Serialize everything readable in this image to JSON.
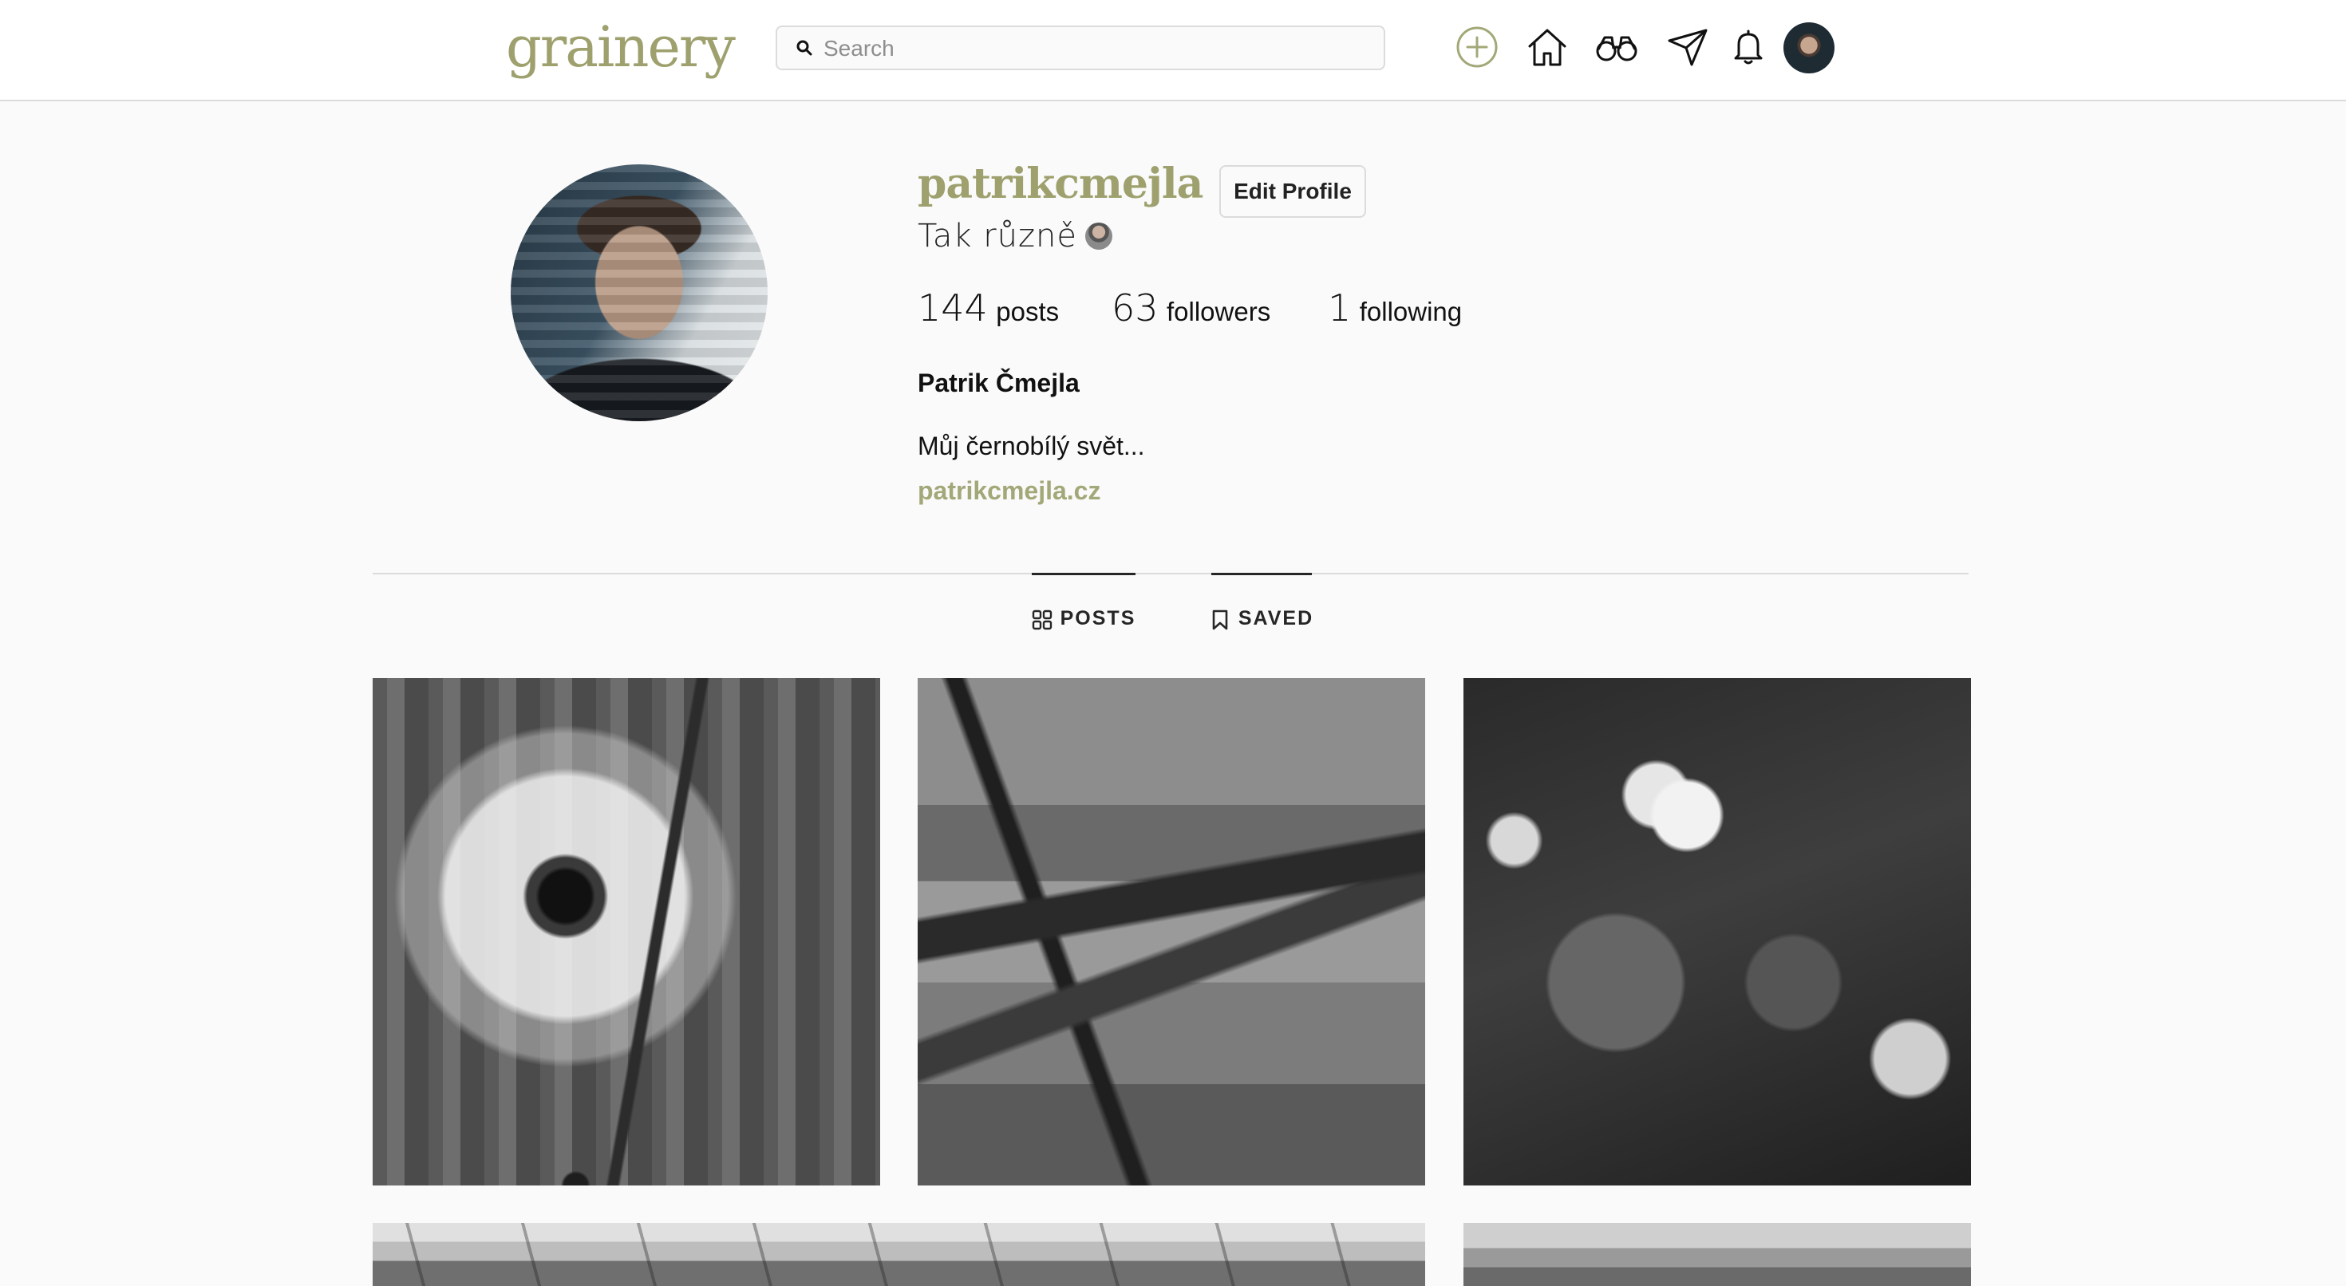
{
  "header": {
    "logo": "grainery",
    "search_placeholder": "Search",
    "icons": [
      "plus-circle-icon",
      "home-icon",
      "binoculars-icon",
      "send-icon",
      "bell-icon",
      "profile-avatar"
    ]
  },
  "profile": {
    "username": "patrikcmejla",
    "edit_label": "Edit Profile",
    "tagline": "Tak různě",
    "stats": {
      "posts": "144",
      "posts_label": "posts",
      "followers": "63",
      "followers_label": "followers",
      "following": "1",
      "following_label": "following"
    },
    "full_name": "Patrik Čmejla",
    "bio": "Můj černobílý svět...",
    "website": "patrikcmejla.cz"
  },
  "tabs": [
    {
      "label": "POSTS",
      "icon": "grid-icon"
    },
    {
      "label": "SAVED",
      "icon": "bookmark-icon"
    }
  ],
  "colors": {
    "brand": "#9ea16e",
    "background": "#fafafa",
    "border": "#dbdbdb"
  },
  "grid": {
    "photos": [
      "black-and-white dandelion seed head",
      "fallen tree over water",
      "apple blossoms",
      "landscape",
      "photo"
    ]
  }
}
